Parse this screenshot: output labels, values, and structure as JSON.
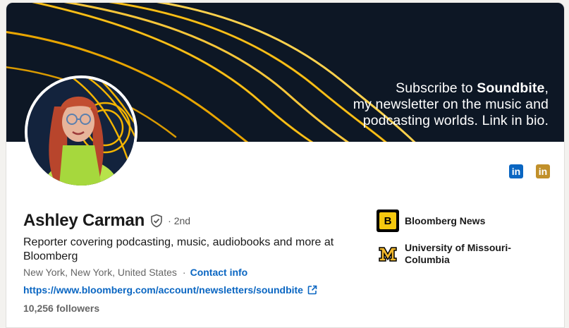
{
  "banner": {
    "line1_prefix": "Subscribe to ",
    "line1_bold": "Soundbite",
    "line1_suffix": ",",
    "line2": "my newsletter on the music and",
    "line3": "podcasting worlds. Link in bio."
  },
  "profile": {
    "name": "Ashley Carman",
    "degree": "· 2nd",
    "headline": "Reporter covering podcasting, music, audiobooks and more at Bloomberg",
    "location": "New York, New York, United States",
    "contact_separator": "·",
    "contact_label": "Contact info",
    "website": "https://www.bloomberg.com/account/newsletters/soundbite",
    "followers": "10,256 followers"
  },
  "header_icons": [
    {
      "name": "linkedin-icon",
      "text": "in",
      "color": "#0a66c2"
    },
    {
      "name": "linkedin-gold-icon",
      "text": "in",
      "color": "#c1902a"
    }
  ],
  "organizations": [
    {
      "name": "Bloomberg News",
      "logo_text": "B"
    },
    {
      "name": "University of Missouri-Columbia",
      "logo_text": "M"
    }
  ],
  "colors": {
    "link_blue": "#0a66c2",
    "banner_bg": "#0d1725",
    "wave_gold": "#f3b400",
    "bloomberg_yellow": "#f5c90f",
    "mizzou_gold": "#f1b82d"
  }
}
